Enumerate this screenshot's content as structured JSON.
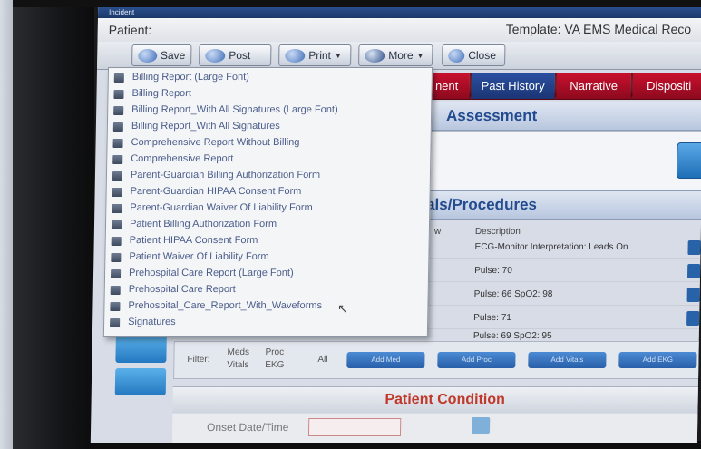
{
  "window": {
    "title": "Incident",
    "patient_label": "Patient:",
    "template_label": "Template: VA EMS Medical Reco"
  },
  "toolbar": {
    "save": "Save",
    "post": "Post",
    "print": "Print",
    "more": "More",
    "close": "Close"
  },
  "tabs": [
    "nent",
    "Past History",
    "Narrative",
    "Dispositi"
  ],
  "sections": {
    "assessment": "Assessment",
    "vitals": "tals/Procedures",
    "patient_condition": "Patient Condition"
  },
  "vitals_table": {
    "col_short": "w",
    "col_description": "Description",
    "rows": [
      "ECG-Monitor Interpretation: Leads On",
      "Pulse: 70",
      "Pulse: 66 SpO2: 98",
      "Pulse: 71",
      "Pulse: 69 SpO2: 95"
    ]
  },
  "filter": {
    "label": "Filter:",
    "options": [
      "Meds",
      "Proc",
      "Vitals",
      "EKG",
      "All"
    ],
    "selected": "All",
    "buttons": [
      "Add Med",
      "Add Proc",
      "Add Vitals",
      "Add EKG"
    ]
  },
  "onset": {
    "label": "Onset Date/Time"
  },
  "print_menu": {
    "items": [
      "Billing Report (Large Font)",
      "Billing Report",
      "Billing Report_With All Signatures (Large Font)",
      "Billing Report_With All Signatures",
      "Comprehensive Report Without Billing",
      "Comprehensive Report",
      "Parent-Guardian Billing Authorization Form",
      "Parent-Guardian HIPAA Consent Form",
      "Parent-Guardian Waiver Of Liability Form",
      "Patient Billing Authorization Form",
      "Patient HIPAA Consent Form",
      "Patient Waiver Of Liability Form",
      "Prehospital Care Report (Large Font)",
      "Prehospital Care Report",
      "Prehospital_Care_Report_With_Waveforms",
      "Signatures"
    ]
  },
  "colors": {
    "tab_red": "#c8102e",
    "tab_blue": "#2b4fa0",
    "section_title_blue": "#234b8f",
    "condition_red": "#c0392b"
  }
}
